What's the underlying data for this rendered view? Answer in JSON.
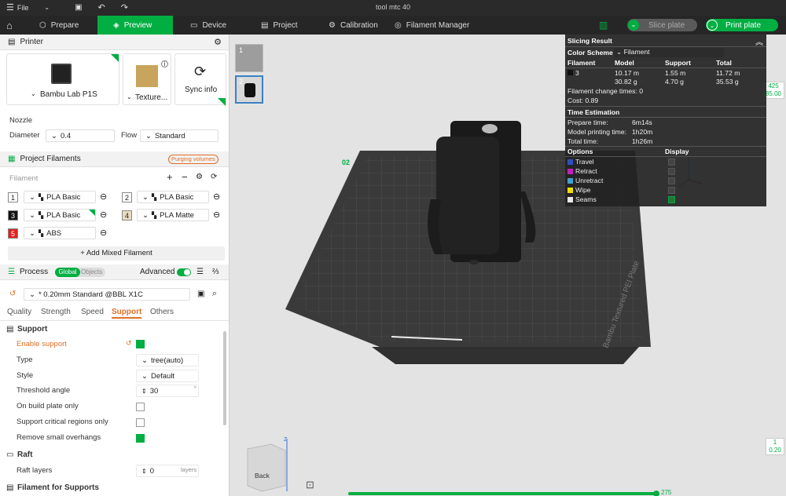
{
  "titlebar": {
    "menu": "File",
    "title": "tool mtc 40"
  },
  "tabs": [
    {
      "label": "Prepare"
    },
    {
      "label": "Preview"
    },
    {
      "label": "Device"
    },
    {
      "label": "Project"
    },
    {
      "label": "Calibration"
    },
    {
      "label": "Filament Manager"
    }
  ],
  "actions": {
    "slice": "Slice plate",
    "print": "Print plate"
  },
  "printer": {
    "section": "Printer",
    "name": "Bambu Lab P1S",
    "plate": "Texture...",
    "sync": "Sync info",
    "nozzle_label": "Nozzle",
    "diameter_label": "Diameter",
    "diameter": "0.4",
    "flow_label": "Flow",
    "flow": "Standard"
  },
  "filaments": {
    "section": "Project Filaments",
    "badge": "Purging volumes",
    "list_label": "Filament",
    "items": [
      {
        "num": "1",
        "name": "PLA Basic",
        "color": "#ffffff",
        "text": "#222"
      },
      {
        "num": "2",
        "name": "PLA Basic",
        "color": "#ffffff",
        "text": "#222"
      },
      {
        "num": "3",
        "name": "PLA Basic",
        "color": "#111111",
        "text": "#fff"
      },
      {
        "num": "4",
        "name": "PLA Matte",
        "color": "#e8dcc0",
        "text": "#222"
      },
      {
        "num": "5",
        "name": "ABS",
        "color": "#e02020",
        "text": "#fff"
      }
    ],
    "add_mixed": "+ Add Mixed Filament"
  },
  "process": {
    "section": "Process",
    "global": "Global",
    "objects": "Objects",
    "advanced": "Advanced",
    "preset": "* 0.20mm Standard @BBL X1C",
    "subtabs": [
      "Quality",
      "Strength",
      "Speed",
      "Support",
      "Others"
    ],
    "support_heading": "Support",
    "rows": [
      {
        "label": "Enable support",
        "value": ""
      },
      {
        "label": "Type",
        "value": "tree(auto)"
      },
      {
        "label": "Style",
        "value": "Default"
      },
      {
        "label": "Threshold angle",
        "value": "30",
        "unit": "°"
      },
      {
        "label": "On build plate only",
        "value": ""
      },
      {
        "label": "Support critical regions only",
        "value": ""
      },
      {
        "label": "Remove small overhangs",
        "value": ""
      }
    ],
    "raft_heading": "Raft",
    "raft_layers_label": "Raft layers",
    "raft_layers": "0",
    "raft_unit": "layers",
    "filament_supports": "Filament for Supports"
  },
  "plates": [
    {
      "num": "1"
    },
    {
      "num": "2"
    }
  ],
  "viewport": {
    "plate_text": "Bambu Textured PEI Plate",
    "plate_num": "02",
    "axis_z": "Z",
    "cube_label": "Back",
    "layer_top": "425",
    "layer_top_h": "85.00",
    "layer_bottom": "1",
    "layer_bottom_h": "0.20",
    "move_value": "275"
  },
  "slicing": {
    "title": "Slicing Result",
    "color_scheme_label": "Color Scheme",
    "color_scheme": "Filament",
    "cols": [
      "Filament",
      "Model",
      "Support",
      "Total"
    ],
    "row": {
      "filament": "3",
      "model_m": "10.17 m",
      "model_g": "30.82 g",
      "support_m": "1.55 m",
      "support_g": "4.70 g",
      "total_m": "11.72 m",
      "total_g": "35.53 g"
    },
    "change_times": "Filament change times: 0",
    "cost": "Cost: 0.89",
    "time_title": "Time Estimation",
    "prepare_label": "Prepare time:",
    "prepare": "6m14s",
    "model_label": "Model printing time:",
    "model": "1h20m",
    "total_label": "Total time:",
    "total": "1h26m",
    "options_label": "Options",
    "display_label": "Display",
    "options": [
      {
        "name": "Travel",
        "color": "#3050c0"
      },
      {
        "name": "Retract",
        "color": "#c020c0"
      },
      {
        "name": "Unretract",
        "color": "#40a0d0"
      },
      {
        "name": "Wipe",
        "color": "#f0e000"
      },
      {
        "name": "Seams",
        "color": "#e8e8e8"
      }
    ]
  },
  "colors": {
    "accent": "#00ae42",
    "support_orange": "#e0702a"
  }
}
